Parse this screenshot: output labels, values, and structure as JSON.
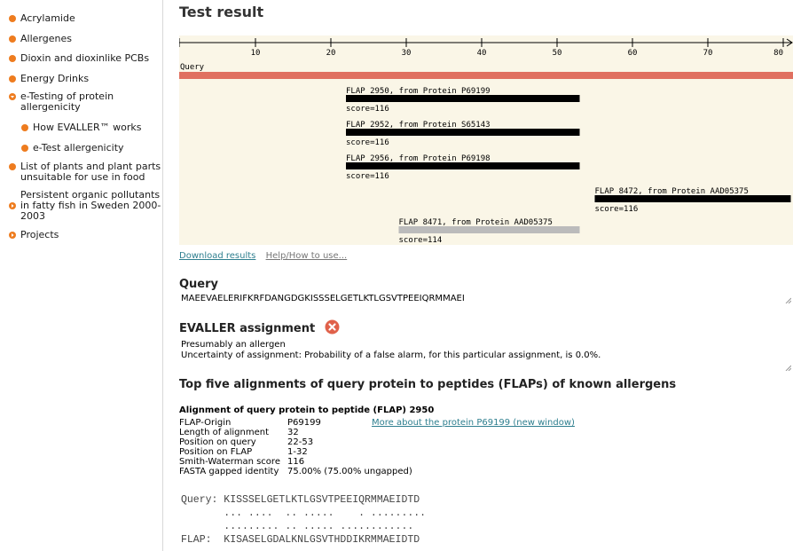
{
  "sidebar": {
    "items": [
      {
        "label": "Acrylamide",
        "icon": "bullet-icon"
      },
      {
        "label": "Allergenes",
        "icon": "bullet-icon"
      },
      {
        "label": "Dioxin and dioxinlike PCBs",
        "icon": "bullet-icon"
      },
      {
        "label": "Energy Drinks",
        "icon": "bullet-icon"
      },
      {
        "label": "e-Testing of protein allergenicity",
        "icon": "expanded-arrow-icon"
      },
      {
        "label": "How EVALLER™ works",
        "icon": "bullet-icon"
      },
      {
        "label": "e-Test allergenicity",
        "icon": "bullet-icon"
      },
      {
        "label": "List of plants and plant parts unsuitable for use in food",
        "icon": "bullet-icon"
      },
      {
        "label": "Persistent organic pollutants in fatty fish in Sweden 2000-2003",
        "icon": "collapsed-arrow-icon"
      },
      {
        "label": "Projects",
        "icon": "collapsed-arrow-icon"
      }
    ],
    "accent_color": "#ee7c1f"
  },
  "page_title": "Test result",
  "track": {
    "ruler_ticks": [
      10,
      20,
      30,
      40,
      50,
      60,
      70,
      80
    ],
    "ruler_max": 80,
    "query_label": "Query",
    "query_color": "#e07060",
    "flaps": [
      {
        "label": "FLAP 2950, from Protein P69199",
        "score": "score=116",
        "start": 22,
        "end": 53,
        "color": "#000000"
      },
      {
        "label": "FLAP 2952, from Protein S65143",
        "score": "score=116",
        "start": 22,
        "end": 53,
        "color": "#000000"
      },
      {
        "label": "FLAP 2956, from Protein P69198",
        "score": "score=116",
        "start": 22,
        "end": 53,
        "color": "#000000"
      },
      {
        "label": "FLAP 8472, from Protein AAD05375",
        "score": "score=116",
        "start": 55,
        "end": 81,
        "color": "#000000"
      },
      {
        "label": "FLAP 8471, from Protein AAD05375",
        "score": "score=114",
        "start": 29,
        "end": 53,
        "color": "#bbbbbb"
      }
    ]
  },
  "links": {
    "download": "Download results",
    "help": "Help/How to use..."
  },
  "query_section": {
    "title": "Query",
    "sequence": "MAEEVAELERIFKRFDANGDGKISSSELGETLKTLGSVTPEEIQRMMAEI"
  },
  "assignment_section": {
    "title": "EVALLER assignment",
    "line1": "Presumably an allergen",
    "line2": "Uncertainty of assignment: Probability of a false alarm, for this particular assignment, is 0.0%.",
    "icon_color": "#e0614a"
  },
  "top_five_title": "Top five alignments of query protein to peptides (FLAPs) of known allergens",
  "alignment": {
    "title": "Alignment of query protein to peptide (FLAP) 2950",
    "rows": [
      {
        "key": "FLAP-Origin",
        "value": "P69199"
      },
      {
        "key": "Length of alignment",
        "value": "32"
      },
      {
        "key": "Position on query",
        "value": "22-53"
      },
      {
        "key": "Position on FLAP",
        "value": "1-32"
      },
      {
        "key": "Smith-Waterman score",
        "value": "116"
      },
      {
        "key": "FASTA gapped identity",
        "value": "75.00% (75.00% ungapped)"
      }
    ],
    "more_link": "More about the protein P69199 (new window)",
    "query_line": "Query: KISSSELGETLKTLGSVTPEEIQRMMAEIDTD",
    "match_line1": "       ... ....  .. .....    . .........",
    "match_line2": "       ......... .. ..... ............",
    "flap_line": "FLAP:  KISASELGDALKNLGSVTHDDIKRMMAEIDTD"
  }
}
